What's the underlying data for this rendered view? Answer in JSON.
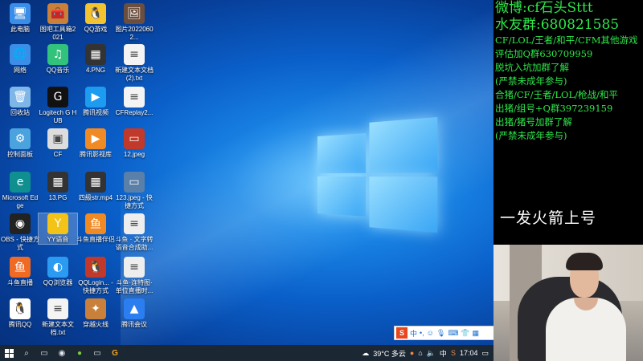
{
  "desktop": {
    "icons": [
      {
        "label": "此电脑",
        "glyph": "🖥",
        "bg": "#3a8ee8"
      },
      {
        "label": "图吧工具箱2021",
        "glyph": "🧰",
        "bg": "#c9803a"
      },
      {
        "label": "QQ游戏",
        "glyph": "🐧",
        "bg": "#f4c430"
      },
      {
        "label": "图片20220602...",
        "glyph": "🖼",
        "bg": "#6b4e3d"
      },
      {
        "label": "网络",
        "glyph": "🌐",
        "bg": "#3a8ee8"
      },
      {
        "label": "QQ音乐",
        "glyph": "♫",
        "bg": "#31c27c"
      },
      {
        "label": "4.PNG",
        "glyph": "▦",
        "bg": "#333333"
      },
      {
        "label": "新建文本文档(2).txt",
        "glyph": "≡",
        "bg": "#f4f4f4"
      },
      {
        "label": "回收站",
        "glyph": "🗑",
        "bg": "#7fb6e8"
      },
      {
        "label": "Logitech G HUB",
        "glyph": "G",
        "bg": "#111111"
      },
      {
        "label": "腾讯视频",
        "glyph": "▶",
        "bg": "#1d9bf0"
      },
      {
        "label": "CFReplay2...",
        "glyph": "≡",
        "bg": "#f4f4f4"
      },
      {
        "label": "控制面板",
        "glyph": "⚙",
        "bg": "#4aa3df"
      },
      {
        "label": "CF",
        "glyph": "▣",
        "bg": "#dddddd"
      },
      {
        "label": "腾讯影视库",
        "glyph": "▶",
        "bg": "#f08a24"
      },
      {
        "label": "12.jpeg",
        "glyph": "▭",
        "bg": "#c0392b"
      },
      {
        "label": "Microsoft Edge",
        "glyph": "e",
        "bg": "#0f8f8f"
      },
      {
        "label": "13.PG",
        "glyph": "▦",
        "bg": "#333333"
      },
      {
        "label": "四級str.mp4",
        "glyph": "▦",
        "bg": "#333333"
      },
      {
        "label": "123.jpeg - 快捷方式",
        "glyph": "▭",
        "bg": "#5a7fa8"
      },
      {
        "label": "OBS - 快捷方式",
        "glyph": "◉",
        "bg": "#222222"
      },
      {
        "label": "YY语音",
        "glyph": "Y",
        "bg": "#f3c318"
      },
      {
        "label": "斗鱼直播伴侣",
        "glyph": "鱼",
        "bg": "#f08a24"
      },
      {
        "label": "斗鱼 · 文字转语音合成助...",
        "glyph": "≡",
        "bg": "#eeeeee"
      },
      {
        "label": "斗鱼直播",
        "glyph": "鱼",
        "bg": "#f06a24"
      },
      {
        "label": "QQ浏览器",
        "glyph": "◐",
        "bg": "#2a9bf0"
      },
      {
        "label": "QQLogin... - 快捷方式",
        "glyph": "🐧",
        "bg": "#c0392b"
      },
      {
        "label": "斗鱼·连特图·单位直播时...",
        "glyph": "≡",
        "bg": "#eeeeee"
      },
      {
        "label": "腾讯QQ",
        "glyph": "🐧",
        "bg": "#ffffff"
      },
      {
        "label": "新建文本文档.txt",
        "glyph": "≡",
        "bg": "#f4f4f4"
      },
      {
        "label": "穿越火线",
        "glyph": "✦",
        "bg": "#c9803a"
      },
      {
        "label": "腾讯会议",
        "glyph": "▲",
        "bg": "#2a7ef0"
      }
    ]
  },
  "taskbar": {
    "weather": "39°C 多云",
    "lang": "中",
    "time": "17:04",
    "icons": [
      "windows-icon",
      "search-icon",
      "task-view-icon",
      "obs-icon",
      "app-green-icon",
      "app-window-icon",
      "g-hub-icon"
    ]
  },
  "ime": {
    "logo": "S",
    "label": "中"
  },
  "overlay": {
    "line1": "微博:cf石头Sttt",
    "line2": "水友群:680821585",
    "lines": [
      "CF/LOL/王者/和平/CFM其他游戏",
      "评估加Q群630709959",
      "脱坑入坑加群了解",
      "(严禁未成年参与)",
      "合猪/CF/王者/LOL/枪战/和平",
      "出猪/组号+Q群397239159",
      "出猪/猪号加群了解",
      "(严禁未成年参与)"
    ],
    "tagline": "一发火箭上号"
  },
  "colors": {
    "overlay_text": "#2ee84a",
    "taskbar": "#1b2733"
  }
}
